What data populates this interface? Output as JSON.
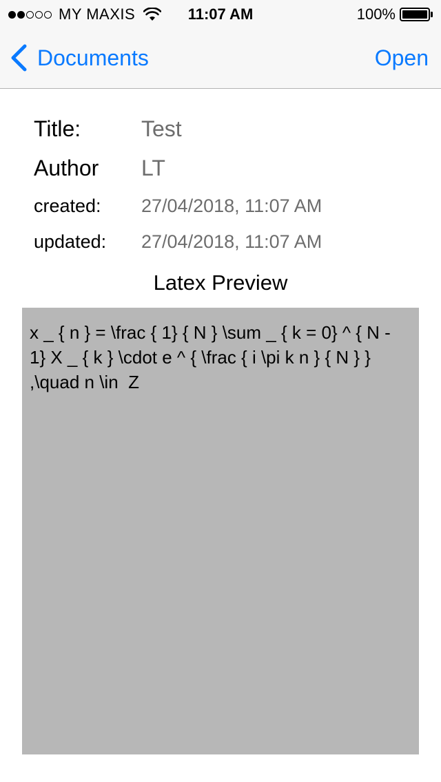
{
  "status_bar": {
    "signal_filled": 2,
    "signal_total": 5,
    "carrier": "MY MAXIS",
    "time": "11:07 AM",
    "battery_percent": "100%",
    "wifi_icon": "wifi-icon",
    "battery_icon": "battery-icon"
  },
  "nav": {
    "back_label": "Documents",
    "back_icon": "chevron-left-icon",
    "open_label": "Open",
    "accent_color": "#0a7aff"
  },
  "document": {
    "title_label": "Title:",
    "title_value": "Test",
    "author_label": "Author",
    "author_value": "LT",
    "created_label": "created:",
    "created_value": "27/04/2018, 11:07 AM",
    "updated_label": "updated:",
    "updated_value": "27/04/2018, 11:07 AM"
  },
  "preview": {
    "heading": "Latex Preview",
    "latex": "x _ { n } = \\frac { 1} { N } \\sum _ { k = 0} ^ { N - 1} X _ { k } \\cdot e ^ { \\frac { i \\pi k n } { N } } ,\\quad n \\in  Z",
    "background_color": "#b7b7b7"
  }
}
